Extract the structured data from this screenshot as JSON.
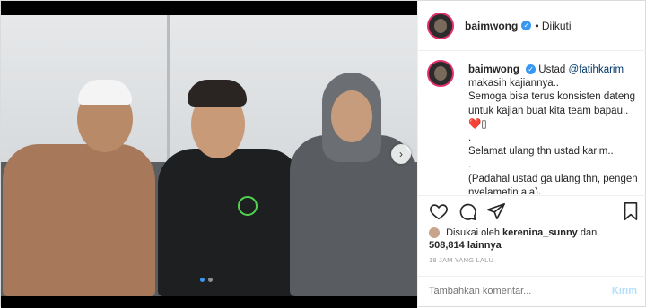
{
  "post": {
    "username": "baimwong",
    "follow_status": "• Diikuti",
    "verified_mark": "✓"
  },
  "caption": {
    "username": "baimwong",
    "prefix": "Ustad",
    "mention": "@fatihkarim",
    "lines": [
      "makasih kajiannya..",
      "Semoga bisa terus konsisten dateng",
      "untuk kajian buat kita team bapau..",
      "❤️▯",
      ".",
      "Selamat ulang thn ustad karim..",
      ".",
      "(Padahal ustad ga ulang thn, pengen",
      "nyelametin aja)."
    ]
  },
  "likes": {
    "prefix": "Disukai oleh",
    "liker": "kerenina_sunny",
    "connector": "dan",
    "count": "508,814",
    "suffix": "lainnya"
  },
  "timestamp": "18 JAM YANG LALU",
  "comment": {
    "placeholder": "Tambahkan komentar...",
    "post_label": "Kirim"
  },
  "carousel": {
    "next_glyph": "›",
    "slide_count": 2,
    "active_slide": 1
  },
  "icons": [
    "heart-icon",
    "comment-icon",
    "share-icon",
    "bookmark-icon",
    "verified-icon",
    "chevron-right-icon"
  ],
  "colors": {
    "accent": "#3897f0",
    "mention": "#003569",
    "post_button_disabled": "#b2dffc"
  }
}
